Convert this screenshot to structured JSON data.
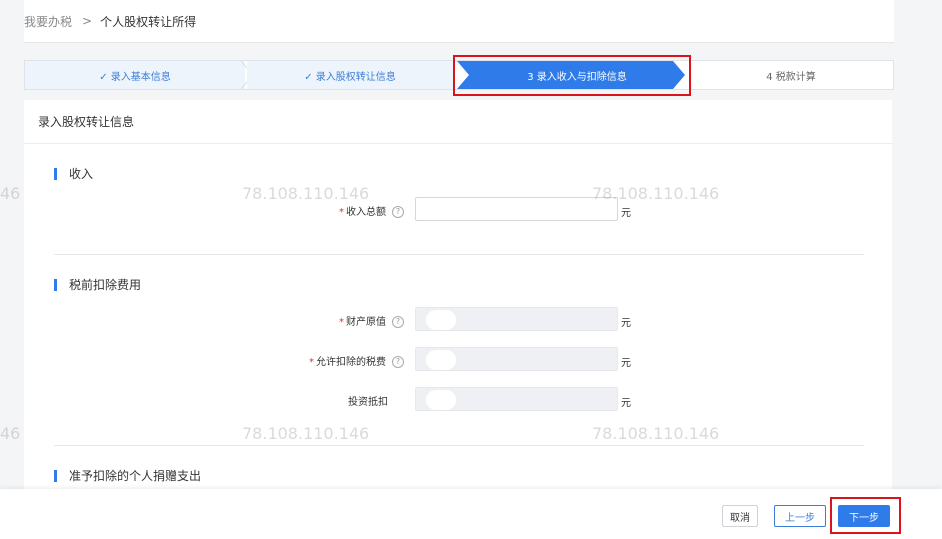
{
  "breadcrumb": {
    "home": "我要办税",
    "separator": ">",
    "current": "个人股权转让所得"
  },
  "steps": [
    {
      "label": "✓ 录入基本信息",
      "state": "done"
    },
    {
      "label": "✓ 录入股权转让信息",
      "state": "done"
    },
    {
      "label": "3  录入收入与扣除信息",
      "state": "active"
    },
    {
      "label": "4  税款计算",
      "state": "todo"
    }
  ],
  "card": {
    "title": "录入股权转让信息"
  },
  "sections": {
    "income": {
      "title": "收入",
      "fields": {
        "total_income": {
          "label": "收入总额",
          "required": true,
          "unit": "元",
          "value": ""
        }
      }
    },
    "deductions": {
      "title": "税前扣除费用",
      "fields": {
        "original_value": {
          "label": "财产原值",
          "required": true,
          "unit": "元",
          "value": ""
        },
        "allowed_taxes": {
          "label": "允许扣除的税费",
          "required": true,
          "unit": "元",
          "value": ""
        },
        "investment_offset": {
          "label": "投资抵扣",
          "required": false,
          "unit": "元",
          "value": ""
        }
      }
    },
    "donation": {
      "title": "准予扣除的个人捐赠支出"
    }
  },
  "common": {
    "required_mark": "*",
    "help_glyph": "?"
  },
  "footer": {
    "cancel": "取消",
    "prev": "上一步",
    "next": "下一步"
  },
  "watermark": [
    "46",
    "78.108.110.146",
    "78.108.110.146",
    "46",
    "78.108.110.146",
    "78.108.110.146"
  ],
  "colors": {
    "primary": "#2f7bea",
    "highlight_box": "#d9141c",
    "required": "#e0332a"
  }
}
